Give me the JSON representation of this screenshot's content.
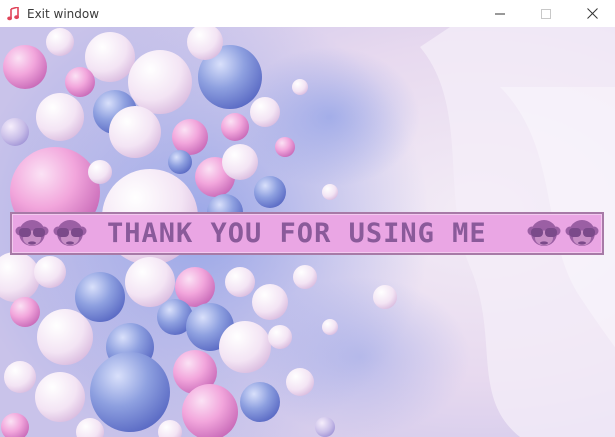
{
  "window": {
    "title": "Exit window",
    "app_icon": "music-note-icon",
    "controls": [
      "minimize-icon",
      "maximize-icon",
      "close-icon"
    ]
  },
  "banner": {
    "message": "THANK YOU FOR USING ME",
    "left_icons": [
      "see-no-evil-monkey-icon",
      "see-no-evil-monkey-icon"
    ],
    "right_icons": [
      "see-no-evil-monkey-icon",
      "see-no-evil-monkey-icon"
    ],
    "background_color": "#eaa6e4",
    "text_color": "#8a5a9a",
    "border_color": "#a77aa7"
  },
  "background": {
    "description_colors": [
      "#8ea0e0",
      "#f2a6dc",
      "#ece0f0",
      "#6f7fd0"
    ]
  }
}
